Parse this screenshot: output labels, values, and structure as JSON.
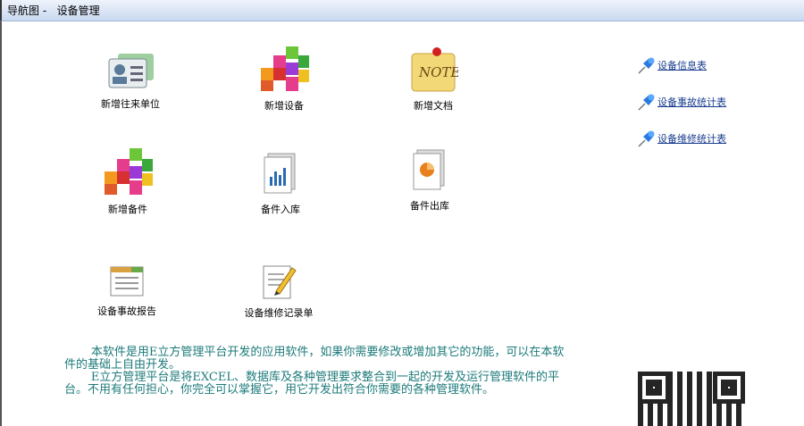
{
  "title": {
    "nav": "导航图 -",
    "page": "设备管理"
  },
  "tiles": [
    {
      "label": "新增往来单位",
      "icon": "contact-card-icon"
    },
    {
      "label": "新增设备",
      "icon": "colored-cubes-icon"
    },
    {
      "label": "新增文档",
      "icon": "note-icon"
    },
    {
      "label": "新增备件",
      "icon": "colored-cubes-icon"
    },
    {
      "label": "备件入库",
      "icon": "chart-document-icon"
    },
    {
      "label": "备件出库",
      "icon": "pie-document-icon"
    },
    {
      "label": "设备事故报告",
      "icon": "window-report-icon"
    },
    {
      "label": "设备维修记录单",
      "icon": "pencil-document-icon"
    }
  ],
  "links": [
    {
      "label": "设备信息表",
      "icon": "pushpin-icon"
    },
    {
      "label": "设备事故统计表",
      "icon": "pushpin-icon"
    },
    {
      "label": "设备维修统计表",
      "icon": "pushpin-icon"
    }
  ],
  "intro": {
    "p1": "本软件是用E立方管理平台开发的应用软件，如果你需要修改或增加其它的功能，可以在本软件的基础上自由开发。",
    "p2": "E立方管理平台是将EXCEL、数据库及各种管理要求整合到一起的开发及运行管理软件的平台。不用有任何担心，你完全可以掌握它，用它开发出符合你需要的各种管理软件。"
  }
}
